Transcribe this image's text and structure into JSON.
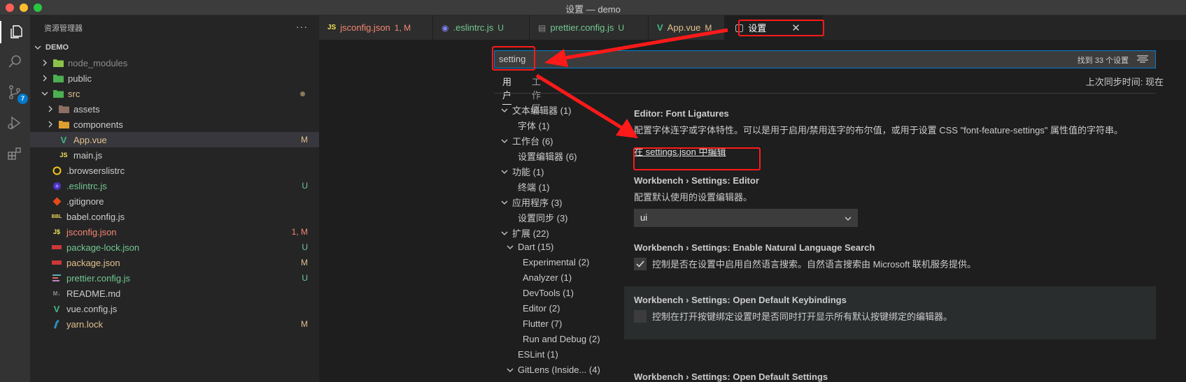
{
  "window": {
    "title": "设置 — demo"
  },
  "activity": {
    "scm_badge": "7"
  },
  "sidebar": {
    "title": "资源管理器",
    "more": "···",
    "root": "DEMO",
    "items": [
      {
        "label": "node_modules",
        "icon": "folder-node-icon",
        "status": ""
      },
      {
        "label": "public",
        "icon": "folder-public-icon",
        "status": ""
      },
      {
        "label": "src",
        "icon": "folder-src-icon",
        "status": ""
      },
      {
        "label": "assets",
        "icon": "folder-assets-icon",
        "status": ""
      },
      {
        "label": "components",
        "icon": "folder-components-icon",
        "status": ""
      },
      {
        "label": "App.vue",
        "icon": "vue-icon",
        "status": "M"
      },
      {
        "label": "main.js",
        "icon": "js-icon",
        "status": ""
      },
      {
        "label": ".browserslistrc",
        "icon": "browserslist-icon",
        "status": ""
      },
      {
        "label": ".eslintrc.js",
        "icon": "eslint-icon",
        "status": "U"
      },
      {
        "label": ".gitignore",
        "icon": "git-icon",
        "status": ""
      },
      {
        "label": "babel.config.js",
        "icon": "babel-icon",
        "status": ""
      },
      {
        "label": "jsconfig.json",
        "icon": "js-json-icon",
        "status": "1, M"
      },
      {
        "label": "package-lock.json",
        "icon": "npm-icon",
        "status": "U"
      },
      {
        "label": "package.json",
        "icon": "npm-icon",
        "status": "M"
      },
      {
        "label": "prettier.config.js",
        "icon": "prettier-icon",
        "status": "U"
      },
      {
        "label": "README.md",
        "icon": "markdown-icon",
        "status": ""
      },
      {
        "label": "vue.config.js",
        "icon": "vue-icon",
        "status": ""
      },
      {
        "label": "yarn.lock",
        "icon": "yarn-icon",
        "status": "M"
      }
    ]
  },
  "tabs": [
    {
      "label": "jsconfig.json",
      "status": "1, M",
      "icon": "JS"
    },
    {
      "label": ".eslintrc.js",
      "status": "U",
      "icon": "◉"
    },
    {
      "label": "prettier.config.js",
      "status": "U",
      "icon": "▤"
    },
    {
      "label": "App.vue",
      "status": "M",
      "icon": "V"
    },
    {
      "label": "设置",
      "status": "",
      "icon": "▢",
      "close": "✕"
    }
  ],
  "search": {
    "value": "setting",
    "count": "找到 33 个设置"
  },
  "scope_tabs": {
    "user": "用户",
    "workspace": "工作区"
  },
  "sync": "上次同步时间: 现在",
  "toc": [
    {
      "label": "文本编辑器 (1)",
      "expandable": true
    },
    {
      "label": "字体 (1)",
      "expandable": false
    },
    {
      "label": "工作台 (6)",
      "expandable": true
    },
    {
      "label": "设置编辑器 (6)",
      "expandable": false
    },
    {
      "label": "功能 (1)",
      "expandable": true
    },
    {
      "label": "终端 (1)",
      "expandable": false
    },
    {
      "label": "应用程序 (3)",
      "expandable": true
    },
    {
      "label": "设置同步 (3)",
      "expandable": false
    },
    {
      "label": "扩展 (22)",
      "expandable": true
    },
    {
      "label": "Dart (15)",
      "expandable": true
    },
    {
      "label": "Experimental (2)",
      "expandable": false
    },
    {
      "label": "Analyzer (1)",
      "expandable": false
    },
    {
      "label": "DevTools (1)",
      "expandable": false
    },
    {
      "label": "Editor (2)",
      "expandable": false
    },
    {
      "label": "Flutter (7)",
      "expandable": false
    },
    {
      "label": "Run and Debug (2)",
      "expandable": false
    },
    {
      "label": "ESLint (1)",
      "expandable": false
    },
    {
      "label": "GitLens (Inside... (4)",
      "expandable": true
    }
  ],
  "settings": {
    "font_ligatures": {
      "category": "Editor: ",
      "name": "Font Ligatures",
      "desc": "配置字体连字或字体特性。可以是用于启用/禁用连字的布尔值，或用于设置 CSS \"font-feature-settings\" 属性值的字符串。",
      "link": "在 settings.json 中编辑"
    },
    "editor": {
      "category": "Workbench › Settings: ",
      "name": "Editor",
      "desc": "配置默认使用的设置编辑器。",
      "value": "ui"
    },
    "nl_search": {
      "category": "Workbench › Settings: ",
      "name": "Enable Natural Language Search",
      "desc": "控制是否在设置中启用自然语言搜索。自然语言搜索由 Microsoft 联机服务提供。"
    },
    "open_keybindings": {
      "category": "Workbench › Settings: ",
      "name": "Open Default Keybindings",
      "desc": "控制在打开按键绑定设置时是否同时打开显示所有默认按键绑定的编辑器。"
    },
    "open_settings": {
      "category": "Workbench › Settings: ",
      "name": "Open Default Settings"
    }
  },
  "colors": {
    "accent": "#007fd4",
    "annotation": "#ff1a1a",
    "modified": "#e2c08d",
    "untracked": "#73c991",
    "error": "#f48771"
  }
}
